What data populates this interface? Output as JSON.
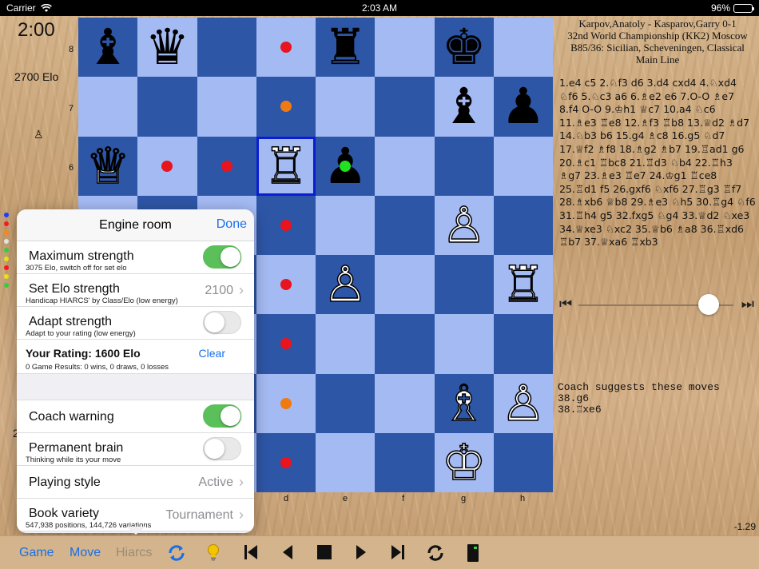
{
  "status": {
    "carrier": "Carrier",
    "time": "2:03 AM",
    "battery": "96%"
  },
  "clock": "2:00",
  "elo": "2700 Elo",
  "side_pawn": "♙",
  "left_two": "2",
  "dots_colors": [
    "#1a3fff",
    "#ff1a1a",
    "#ff8a1a",
    "#e8e8e8",
    "#3ad13a",
    "#e8e81a",
    "#ff1a1a",
    "#e8e81a",
    "#3ad13a"
  ],
  "game": {
    "players": "Karpov,Anatoly - Kasparov,Garry 0-1",
    "event": "32nd World Championship (KK2) Moscow",
    "opening": "B85/36: Sicilian, Scheveningen, Classical",
    "variation": "Main Line",
    "moves": "1.e4 c5 2.♘f3 d6 3.d4 cxd4 4.♘xd4 ♘f6 5.♘c3 a6 6.♗e2 e6 7.O-O ♗e7 8.f4 O-O 9.♔h1 ♕c7 10.a4 ♘c6 11.♗e3 ♖e8 12.♗f3 ♖b8 13.♕d2 ♗d7 14.♘b3 b6 15.g4 ♗c8 16.g5 ♘d7 17.♕f2 ♗f8 18.♗g2 ♗b7 19.♖ad1 g6 20.♗c1 ♖bc8 21.♖d3 ♘b4 22.♖h3 ♗g7 23.♗e3 ♖e7 24.♔g1 ♖ce8 25.♖d1 f5 26.gxf6 ♘xf6 27.♖g3 ♖f7 28.♗xb6 ♕b8 29.♗e3 ♘h5 30.♖g4 ♘f6 31.♖h4 g5 32.fxg5 ♘g4 33.♕d2 ♘xe3 34.♕xe3 ♘xc2 35.♕b6 ♗a8 36.♖xd6 ♖b7 37.♕xa6 ♖xb3"
  },
  "coach": {
    "title": "Coach suggests these moves",
    "line1": "38.g6",
    "line2": "38.♖xe6"
  },
  "eval": "-1.29",
  "ranks": [
    "8",
    "7",
    "6"
  ],
  "files": [
    "d",
    "e",
    "f",
    "g",
    "h"
  ],
  "board": [
    [
      {
        "p": "♝",
        "c": "b"
      },
      {
        "p": "♛",
        "c": "b"
      },
      {},
      {
        "m": "#e8141e"
      },
      {
        "p": "♜",
        "c": "b"
      },
      {},
      {
        "p": "♚",
        "c": "b"
      },
      {}
    ],
    [
      {},
      {},
      {},
      {
        "m": "#f07a12"
      },
      {},
      {},
      {
        "p": "♝",
        "c": "b"
      },
      {
        "p": "♟",
        "c": "b"
      }
    ],
    [
      {
        "p": "♕",
        "c": "w"
      },
      {
        "m": "#e8141e"
      },
      {
        "m": "#e8141e"
      },
      {
        "p": "♖",
        "c": "w",
        "sel": true
      },
      {
        "p": "♟",
        "c": "b",
        "m": "#22e022"
      },
      {},
      {},
      {}
    ],
    [
      {},
      {},
      {},
      {
        "m": "#e8141e"
      },
      {},
      {},
      {
        "p": "♙",
        "c": "w"
      },
      {}
    ],
    [
      {},
      {},
      {},
      {
        "m": "#e8141e"
      },
      {
        "p": "♙",
        "c": "w"
      },
      {},
      {},
      {
        "p": "♖",
        "c": "w"
      }
    ],
    [
      {},
      {},
      {},
      {
        "m": "#e8141e"
      },
      {},
      {},
      {},
      {}
    ],
    [
      {},
      {},
      {},
      {
        "m": "#f07a12"
      },
      {},
      {},
      {
        "p": "♗",
        "c": "w"
      },
      {
        "p": "♙",
        "c": "w"
      }
    ],
    [
      {},
      {},
      {},
      {
        "m": "#e8141e"
      },
      {},
      {},
      {
        "p": "♔",
        "c": "w"
      },
      {}
    ]
  ],
  "popover": {
    "title": "Engine room",
    "done": "Done",
    "max_strength": {
      "label": "Maximum strength",
      "sub": "3075 Elo, switch off for set elo",
      "on": true
    },
    "set_elo": {
      "label": "Set Elo strength",
      "sub": "Handicap HIARCS' by Class/Elo (low energy)",
      "value": "2100"
    },
    "adapt": {
      "label": "Adapt strength",
      "sub": "Adapt to your rating (low energy)",
      "on": false
    },
    "rating": {
      "title": "Your Rating:  1600 Elo",
      "clear": "Clear",
      "results": "0 Game Results:  0 wins, 0 draws, 0 losses"
    },
    "coach_warning": {
      "label": "Coach warning",
      "on": true
    },
    "permanent_brain": {
      "label": "Permanent brain",
      "sub": "Thinking while its your move",
      "on": false
    },
    "playing_style": {
      "label": "Playing style",
      "value": "Active"
    },
    "book_variety": {
      "label": "Book variety",
      "sub": "547,938 positions, 144,726 variations",
      "value": "Tournament"
    }
  },
  "toolbar": {
    "game": "Game",
    "move": "Move",
    "hiarcs": "Hiarcs",
    "icons": [
      "sync-icon",
      "lightbulb-icon",
      "first-icon",
      "back-icon",
      "stop-icon",
      "forward-icon",
      "last-icon",
      "flip-icon",
      "engine-icon"
    ]
  }
}
